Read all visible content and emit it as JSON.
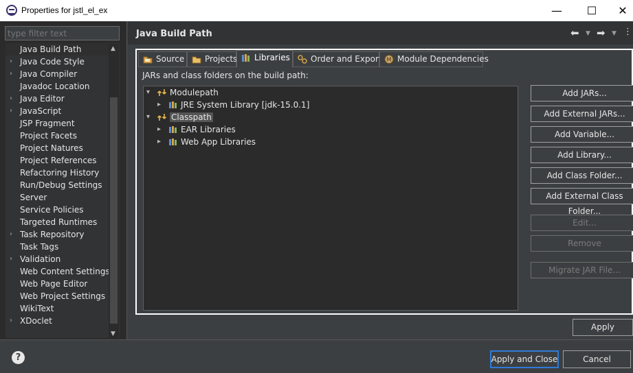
{
  "window": {
    "title": "Properties for jstl_el_ex",
    "minimize_glyph": "—",
    "maximize_glyph": "☐",
    "close_glyph": "✕"
  },
  "filter": {
    "placeholder": "type filter text"
  },
  "nav_items": [
    {
      "label": "Java Build Path",
      "expandable": false
    },
    {
      "label": "Java Code Style",
      "expandable": true
    },
    {
      "label": "Java Compiler",
      "expandable": true
    },
    {
      "label": "Javadoc Location",
      "expandable": false
    },
    {
      "label": "Java Editor",
      "expandable": true
    },
    {
      "label": "JavaScript",
      "expandable": true
    },
    {
      "label": "JSP Fragment",
      "expandable": false
    },
    {
      "label": "Project Facets",
      "expandable": false
    },
    {
      "label": "Project Natures",
      "expandable": false
    },
    {
      "label": "Project References",
      "expandable": false
    },
    {
      "label": "Refactoring History",
      "expandable": false
    },
    {
      "label": "Run/Debug Settings",
      "expandable": false
    },
    {
      "label": "Server",
      "expandable": false
    },
    {
      "label": "Service Policies",
      "expandable": false
    },
    {
      "label": "Targeted Runtimes",
      "expandable": false
    },
    {
      "label": "Task Repository",
      "expandable": true
    },
    {
      "label": "Task Tags",
      "expandable": false
    },
    {
      "label": "Validation",
      "expandable": true
    },
    {
      "label": "Web Content Settings",
      "expandable": false
    },
    {
      "label": "Web Page Editor",
      "expandable": false
    },
    {
      "label": "Web Project Settings",
      "expandable": false
    },
    {
      "label": "WikiText",
      "expandable": false
    },
    {
      "label": "XDoclet",
      "expandable": true
    }
  ],
  "page": {
    "title": "Java Build Path",
    "tabs": [
      {
        "label": "Source",
        "icon": "source-folder-icon"
      },
      {
        "label": "Projects",
        "icon": "projects-icon"
      },
      {
        "label": "Libraries",
        "icon": "libraries-icon"
      },
      {
        "label": "Order and Export",
        "icon": "order-export-icon"
      },
      {
        "label": "Module Dependencies",
        "icon": "module-icon"
      }
    ],
    "active_tab": "Libraries",
    "description": "JARs and class folders on the build path:",
    "tree": [
      {
        "label": "Modulepath",
        "level": 0,
        "expanded": true,
        "icon": "path-icon"
      },
      {
        "label": "JRE System Library [jdk-15.0.1]",
        "level": 1,
        "expanded": false,
        "icon": "library-icon"
      },
      {
        "label": "Classpath",
        "level": 0,
        "expanded": true,
        "icon": "path-icon",
        "selected": true
      },
      {
        "label": "EAR Libraries",
        "level": 1,
        "expanded": false,
        "icon": "library-icon"
      },
      {
        "label": "Web App Libraries",
        "level": 1,
        "expanded": false,
        "icon": "library-icon"
      }
    ],
    "buttons": [
      {
        "label": "Add JARs...",
        "enabled": true
      },
      {
        "label": "Add External JARs...",
        "enabled": true
      },
      {
        "label": "Add Variable...",
        "enabled": true
      },
      {
        "label": "Add Library...",
        "enabled": true
      },
      {
        "label": "Add Class Folder...",
        "enabled": true
      },
      {
        "label": "Add External Class Folder...",
        "enabled": true
      },
      {
        "label": "Edit...",
        "enabled": false
      },
      {
        "label": "Remove",
        "enabled": false
      },
      {
        "label": "Migrate JAR File...",
        "enabled": false
      }
    ],
    "apply_label": "Apply"
  },
  "footer": {
    "help_glyph": "?",
    "apply_close_label": "Apply and Close",
    "cancel_label": "Cancel"
  },
  "colors": {
    "accent": "#2f7bd8",
    "panel_bg": "#3c3f41",
    "tree_bg": "#2b2b2b",
    "library_icon": "#d9a54a"
  }
}
